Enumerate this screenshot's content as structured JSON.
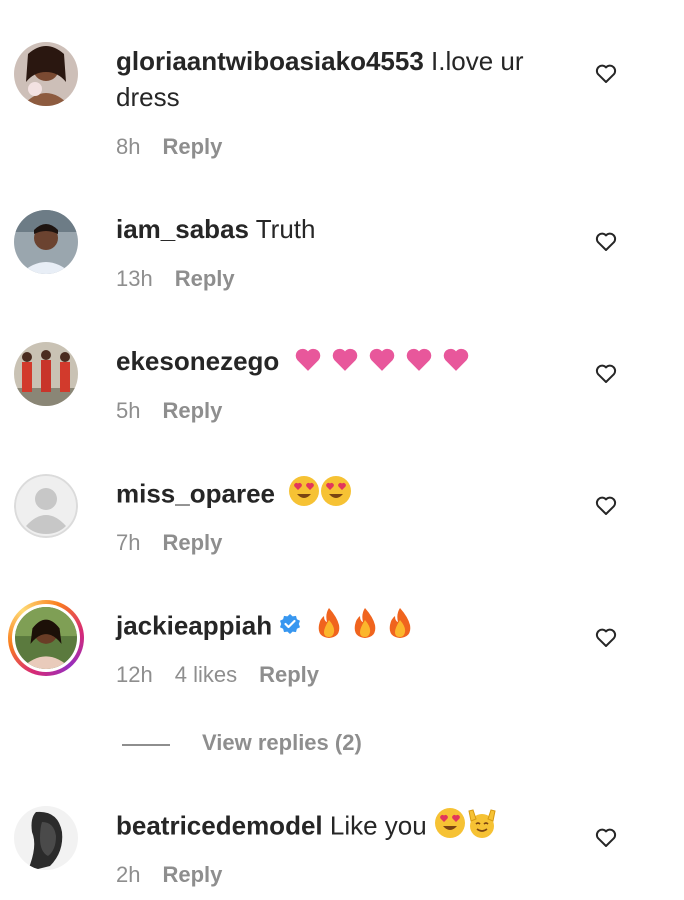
{
  "comments": [
    {
      "username": "gloriaantwiboasiako4553",
      "text": "I.love ur dress",
      "time": "8h",
      "likes": "",
      "reply": "Reply",
      "emoji": []
    },
    {
      "username": "iam_sabas",
      "text": "Truth",
      "time": "13h",
      "likes": "",
      "reply": "Reply",
      "emoji": []
    },
    {
      "username": "ekesonezego",
      "text": "",
      "time": "5h",
      "likes": "",
      "reply": "Reply",
      "emoji": [
        "pink-heart",
        "pink-heart",
        "pink-heart",
        "pink-heart",
        "pink-heart"
      ]
    },
    {
      "username": "miss_oparee",
      "text": "",
      "time": "7h",
      "likes": "",
      "reply": "Reply",
      "emoji": [
        "heart-eyes-face",
        "heart-eyes-face"
      ]
    },
    {
      "username": "jackieappiah",
      "text": "",
      "time": "12h",
      "likes": "4 likes",
      "reply": "Reply",
      "emoji": [
        "fire",
        "fire",
        "fire"
      ],
      "verified": true
    },
    {
      "username": "beatricedemodel",
      "text": "Like you",
      "time": "2h",
      "likes": "",
      "reply": "Reply",
      "emoji": [
        "heart-eyes-face",
        "raising-hands"
      ]
    }
  ],
  "view_replies": "View replies (2)",
  "colors": {
    "secondary": "#8e8e8e",
    "primary": "#262626",
    "verified": "#3897f0"
  }
}
